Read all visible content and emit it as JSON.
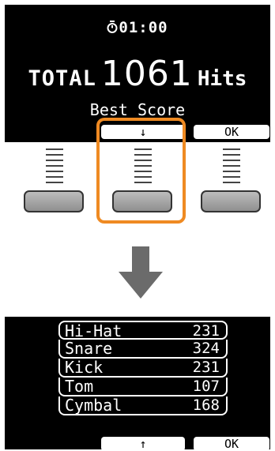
{
  "top_screen": {
    "timer": "01:00",
    "timer_icon": "clock-icon",
    "total_label": "TOTAL",
    "total_value": "1061",
    "total_unit": "Hits",
    "subtitle": "Best Score",
    "softkeys": {
      "left": "↓",
      "right": "OK"
    }
  },
  "highlight_color": "#ef8a22",
  "transition_icon": "down-arrow-icon",
  "bottom_screen": {
    "scores": [
      {
        "name": "Hi-Hat",
        "value": "231"
      },
      {
        "name": "Snare",
        "value": "324"
      },
      {
        "name": "Kick",
        "value": "231"
      },
      {
        "name": "Tom",
        "value": "107"
      },
      {
        "name": "Cymbal",
        "value": "168"
      }
    ],
    "softkeys": {
      "left": "↑",
      "right": "OK"
    }
  }
}
